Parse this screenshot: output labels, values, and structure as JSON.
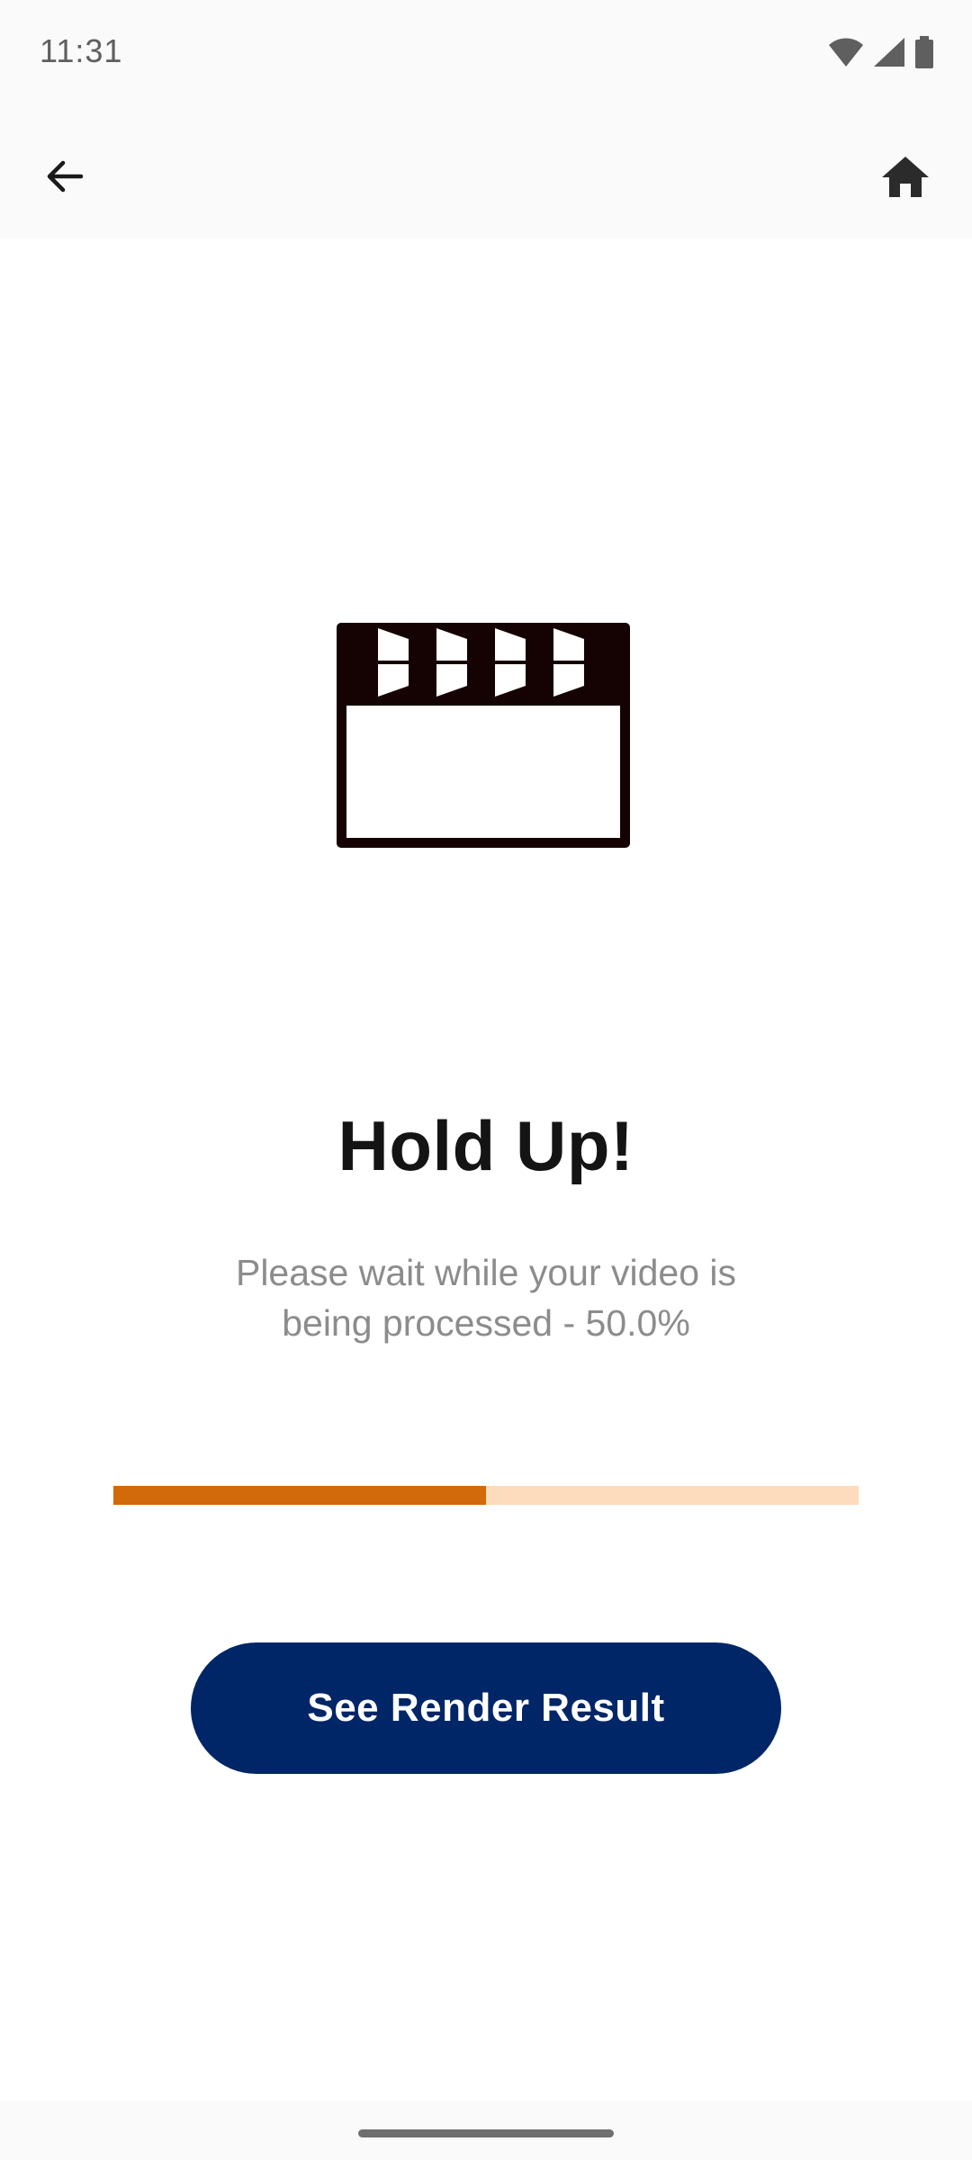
{
  "status_bar": {
    "time": "11:31",
    "icons": [
      "wifi-icon",
      "cell-signal-icon",
      "battery-icon"
    ]
  },
  "app_bar": {
    "back_icon": "arrow-left-icon",
    "home_icon": "home-icon"
  },
  "illustration": {
    "icon": "clapperboard-icon"
  },
  "content": {
    "title": "Hold Up!",
    "message_line1": "Please wait while your video is",
    "message_line2": "being processed - 50.0%",
    "progress_percent": 50.0
  },
  "actions": {
    "see_render_result_label": "See Render Result"
  },
  "colors": {
    "progress_fill": "#d2690a",
    "progress_track": "#fddcbd",
    "button_bg": "#012667",
    "title_text": "#141414",
    "message_text": "#8c8c8c"
  }
}
